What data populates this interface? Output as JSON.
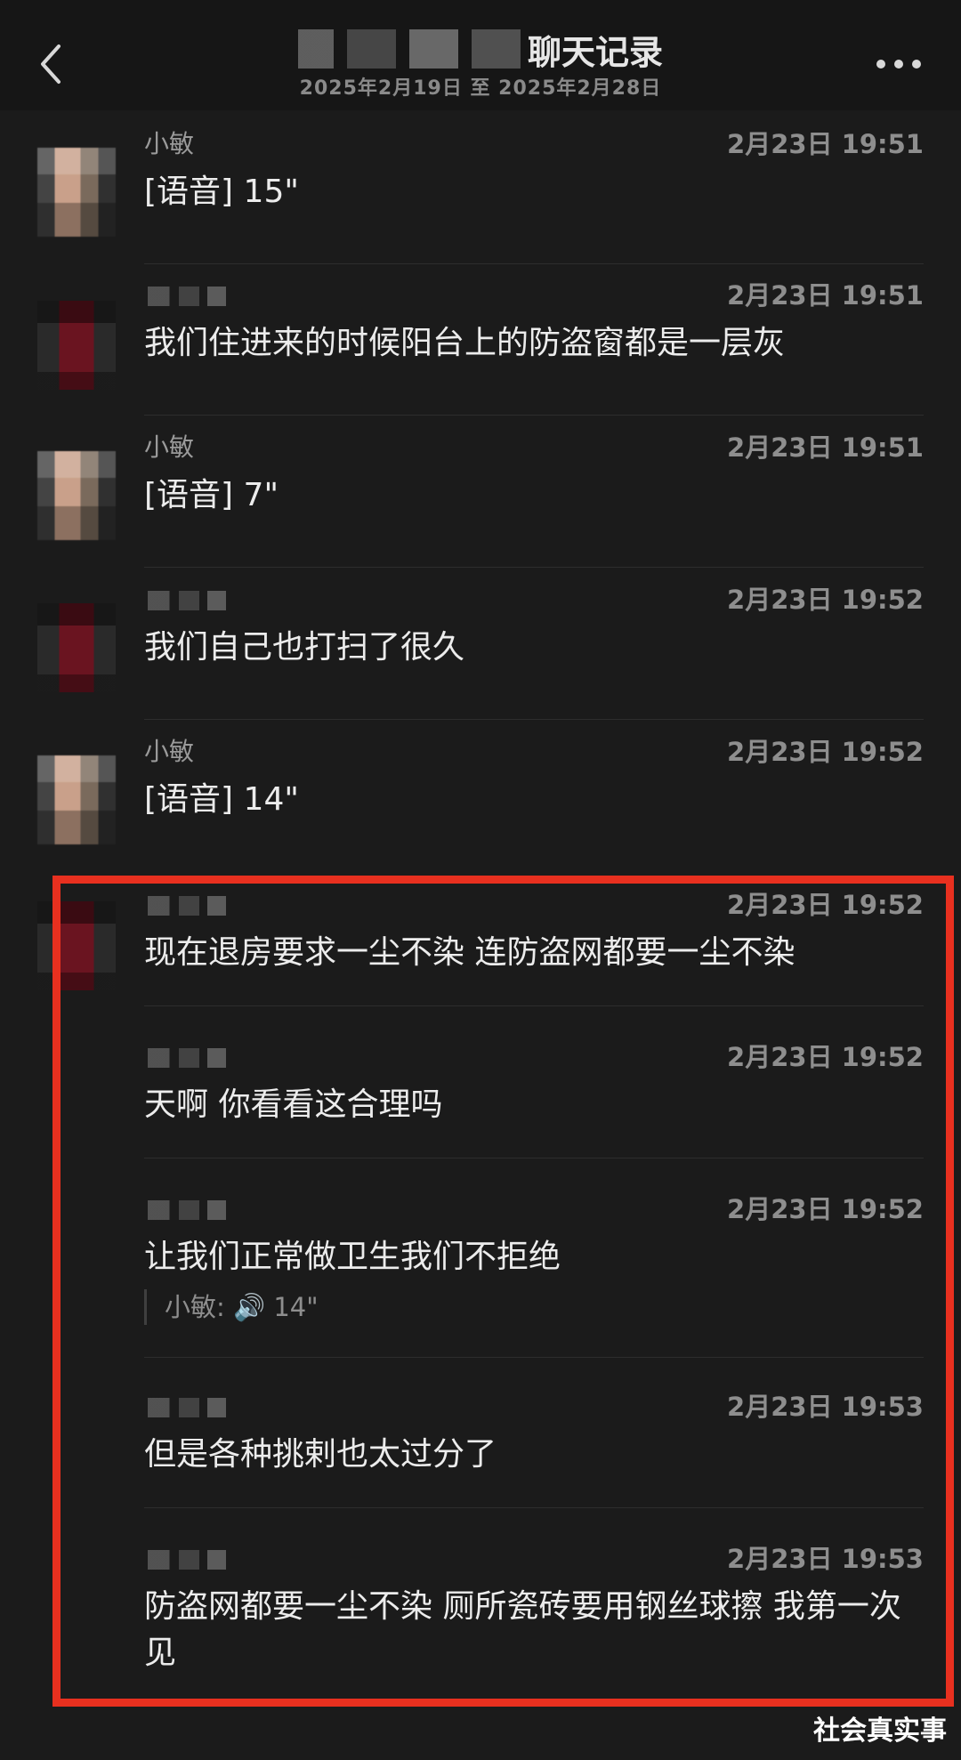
{
  "header": {
    "title_suffix": "聊天记录",
    "date_range": "2025年2月19日 至 2025年2月28日"
  },
  "messages": [
    {
      "sender": "小敏",
      "time": "2月23日 19:51",
      "text": "[语音] 15\""
    },
    {
      "sender": "",
      "time": "2月23日 19:51",
      "text": "我们住进来的时候阳台上的防盗窗都是一层灰"
    },
    {
      "sender": "小敏",
      "time": "2月23日 19:51",
      "text": "[语音] 7\""
    },
    {
      "sender": "",
      "time": "2月23日 19:52",
      "text": "我们自己也打扫了很久"
    },
    {
      "sender": "小敏",
      "time": "2月23日 19:52",
      "text": "[语音] 14\""
    },
    {
      "sender": "",
      "time": "2月23日 19:52",
      "text": "现在退房要求一尘不染 连防盗网都要一尘不染"
    },
    {
      "sender": "",
      "time": "2月23日 19:52",
      "text": "天啊 你看看这合理吗"
    },
    {
      "sender": "",
      "time": "2月23日 19:52",
      "text": "让我们正常做卫生我们不拒绝",
      "quote": "小敏: 🔊 14\""
    },
    {
      "sender": "",
      "time": "2月23日 19:53",
      "text": "但是各种挑剌也太过分了"
    },
    {
      "sender": "",
      "time": "2月23日 19:53",
      "text": "防盗网都要一尘不染 厕所瓷砖要用钢丝球擦 我第一次见"
    }
  ],
  "watermark": "社会真实事",
  "colors": {
    "background": "#1b1b1b",
    "highlight_border": "#e8301f"
  },
  "icons": {
    "back": "chevron-left-icon",
    "more": "more-dots-icon"
  }
}
